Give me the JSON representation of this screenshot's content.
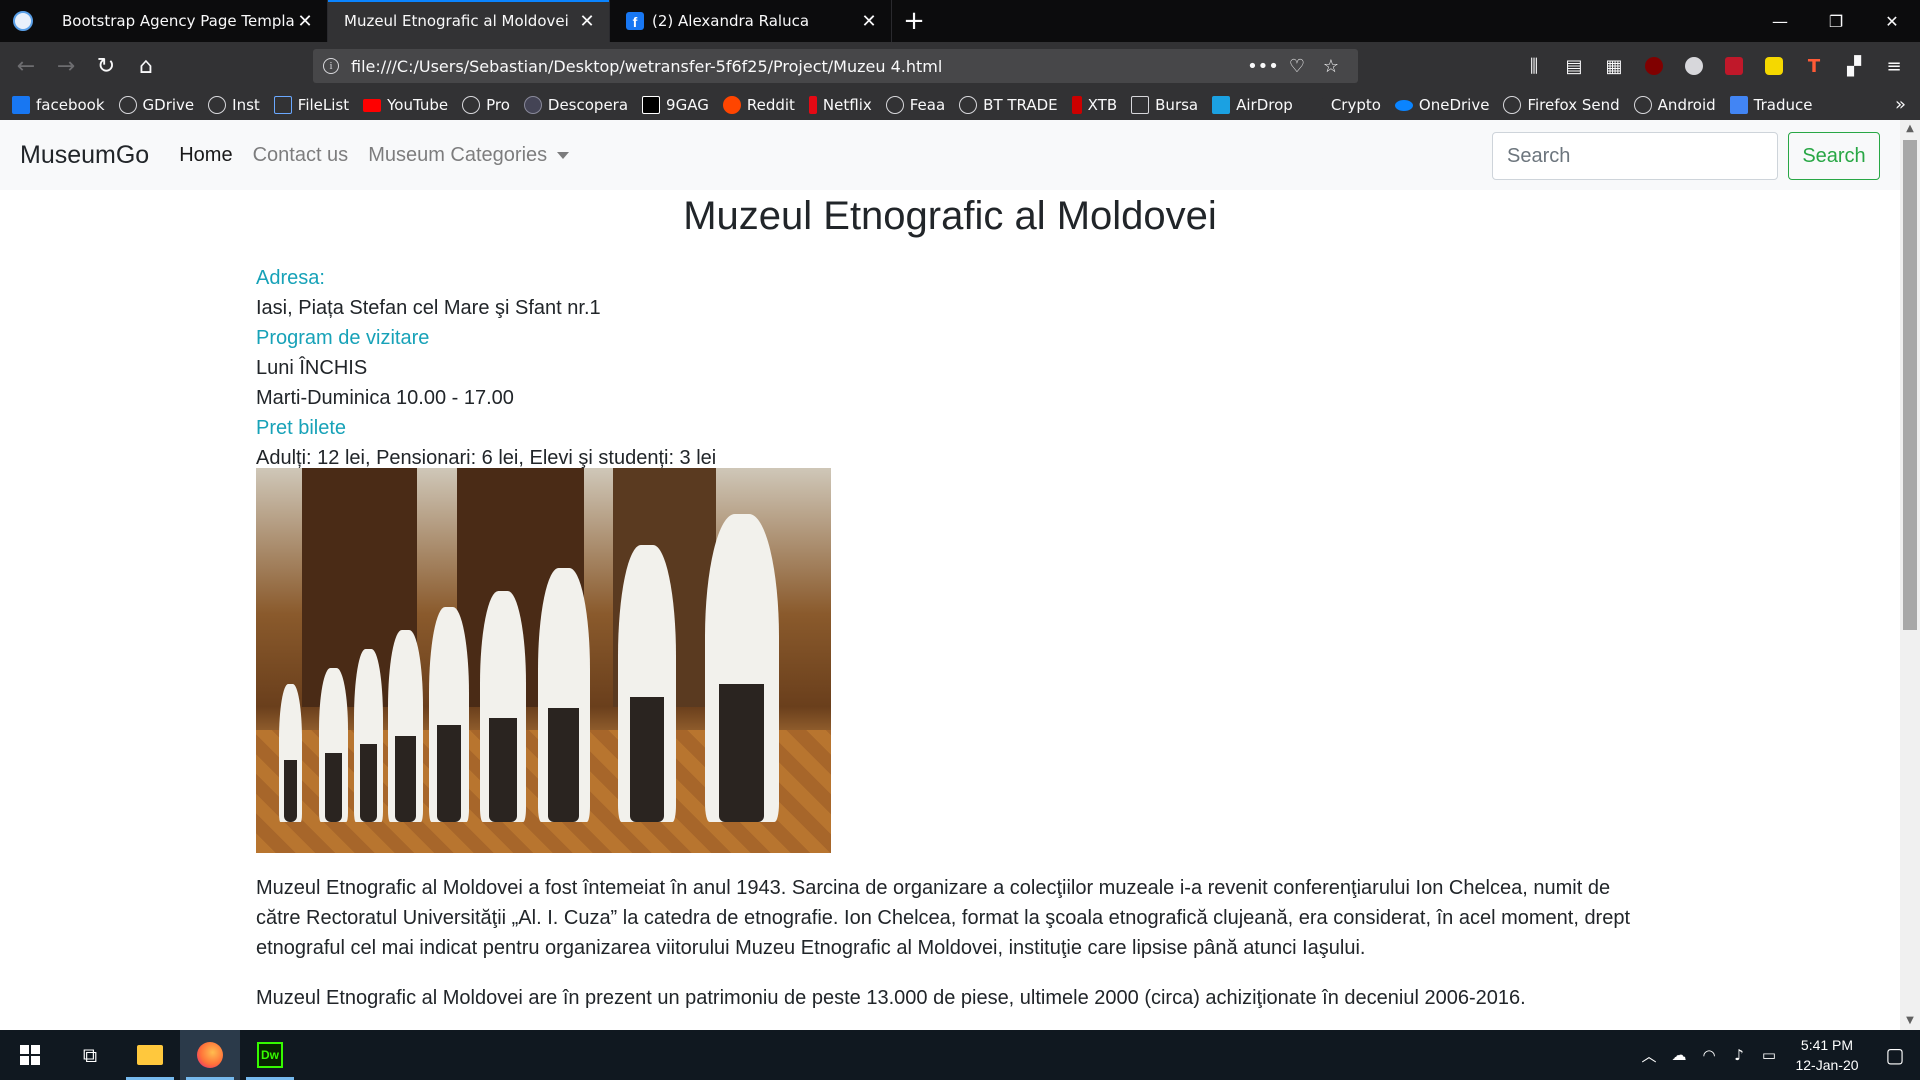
{
  "browser": {
    "tabs": [
      {
        "title": "Bootstrap Agency Page Template",
        "active": false
      },
      {
        "title": "Muzeul Etnografic al Moldovei",
        "active": true
      },
      {
        "title": "(2) Alexandra Raluca",
        "active": false
      }
    ],
    "url": "file:///C:/Users/Sebastian/Desktop/wetransfer-5f6f25/Project/Muzeu 4.html",
    "bookmarks": [
      "facebook",
      "GDrive",
      "Inst",
      "FileList",
      "YouTube",
      "Pro",
      "Descopera",
      "9GAG",
      "Reddit",
      "Netflix",
      "Feaa",
      "BT TRADE",
      "XTB",
      "Bursa",
      "AirDrop",
      "Crypto",
      "OneDrive",
      "Firefox Send",
      "Android",
      "Traduce"
    ],
    "accent": "#0a84ff"
  },
  "site": {
    "brand": "MuseumGo",
    "nav": {
      "home": "Home",
      "contact": "Contact us",
      "categories": "Museum Categories"
    },
    "search": {
      "placeholder": "Search",
      "button": "Search"
    }
  },
  "museum": {
    "title": "Muzeul Etnografic al Moldovei",
    "address_label": "Adresa:",
    "address": "Iasi, Piața Stefan cel Mare şi Sfant nr.1",
    "program_label": "Program de vizitare",
    "program_line1": "Luni ÎNCHIS",
    "program_line2": "Marti-Duminica 10.00 - 17.00",
    "price_label": "Pret bilete",
    "prices": "Adulți: 12 lei, Pensionari: 6 lei, Elevi şi studenți: 3 lei",
    "paragraph1": "Muzeul Etnografic al Moldovei a fost întemeiat în anul 1943. Sarcina de organizare a colecţiilor muzeale i-a revenit conferenţiarului Ion Chelcea, numit de către Rectoratul Universităţii „Al. I. Cuza” la catedra de etnografie. Ion Chelcea, format la şcoala etnografică clujeană, era considerat, în acel moment, drept etnograful cel mai indicat pentru organizarea viitorului Muzeu Etnografic al Moldovei, instituţie care lipsise până atunci Iaşului.",
    "paragraph2": "Muzeul Etnografic al Moldovei are în prezent un patrimoniu de peste 13.000 de piese, ultimele 2000 (circa) achiziţionate în deceniul 2006-2016.",
    "label_color": "#17a2b8"
  },
  "taskbar": {
    "time": "5:41 PM",
    "date": "12-Jan-20",
    "apps": [
      "file-explorer",
      "firefox",
      "dreamweaver"
    ],
    "dw_label": "Dw"
  }
}
